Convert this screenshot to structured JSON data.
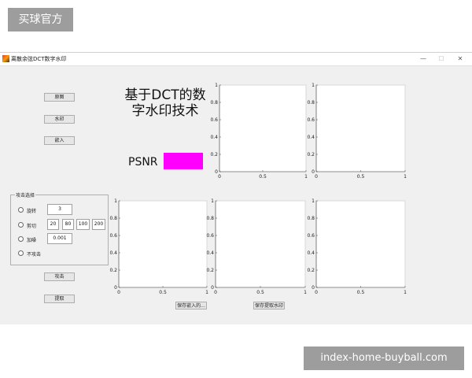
{
  "watermark_top": "买球官方",
  "watermark_bottom": "index-home-buyball.com",
  "window": {
    "title": "离散余弦DCT数字水印",
    "min": "—",
    "max": "☐",
    "close": "✕"
  },
  "buttons": {
    "original": "原图",
    "watermark": "水印",
    "embed": "嵌入",
    "attack": "攻击",
    "extract": "提取",
    "save_embedded": "保存嵌入的...",
    "save_extracted": "保存提取水印"
  },
  "title_line1": "基于DCT的数",
  "title_line2": "字水印技术",
  "psnr": {
    "label": "PSNR",
    "color": "#ff00ff",
    "value": ""
  },
  "attack_group": {
    "title": "攻击选择",
    "options": [
      {
        "label": "旋转",
        "values": [
          "3"
        ]
      },
      {
        "label": "剪切",
        "values": [
          "20",
          "80",
          "100",
          "200"
        ]
      },
      {
        "label": "加噪",
        "values": [
          "0.001"
        ]
      },
      {
        "label": "不攻击",
        "values": []
      }
    ]
  },
  "axes": {
    "x_ticks": [
      "0",
      "0.5",
      "1"
    ],
    "y_ticks": [
      "0",
      "0.2",
      "0.4",
      "0.6",
      "0.8",
      "1"
    ],
    "count": 5
  }
}
